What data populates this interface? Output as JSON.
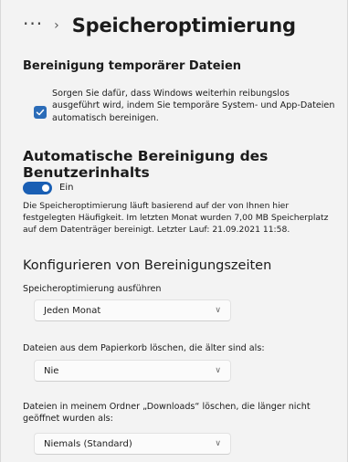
{
  "header": {
    "more_label": "···",
    "separator": "›",
    "title": "Speicheroptimierung"
  },
  "temp_files": {
    "heading": "Bereinigung temporärer Dateien",
    "checkbox_checked": true,
    "checkbox_label": "Sorgen Sie dafür, dass Windows weiterhin reibungslos ausgeführt wird, indem Sie temporäre System- und App-Dateien automatisch bereinigen."
  },
  "auto_cleanup": {
    "heading": "Automatische Bereinigung des Benutzerinhalts",
    "toggle_on": true,
    "toggle_label": "Ein",
    "description": "Die Speicheroptimierung läuft basierend auf der von Ihnen hier festgelegten Häufigkeit. Im letzten Monat wurden 7,00 MB Speicherplatz auf dem Datenträger bereinigt. Letzter Lauf: 21.09.2021 11:58."
  },
  "schedule": {
    "heading": "Konfigurieren von Bereinigungszeiten",
    "run_label": "Speicheroptimierung ausführen",
    "run_value": "Jeden Monat",
    "recycle_label": "Dateien aus dem Papierkorb löschen, die älter sind als:",
    "recycle_value": "Nie",
    "downloads_label": "Dateien in meinem Ordner „Downloads“ löschen, die länger nicht geöffnet wurden als:",
    "downloads_value": "Niemals (Standard)"
  },
  "colors": {
    "accent": "#1a5fb4",
    "checkbox": "#2b6cb8",
    "background": "#f3f3f3"
  }
}
